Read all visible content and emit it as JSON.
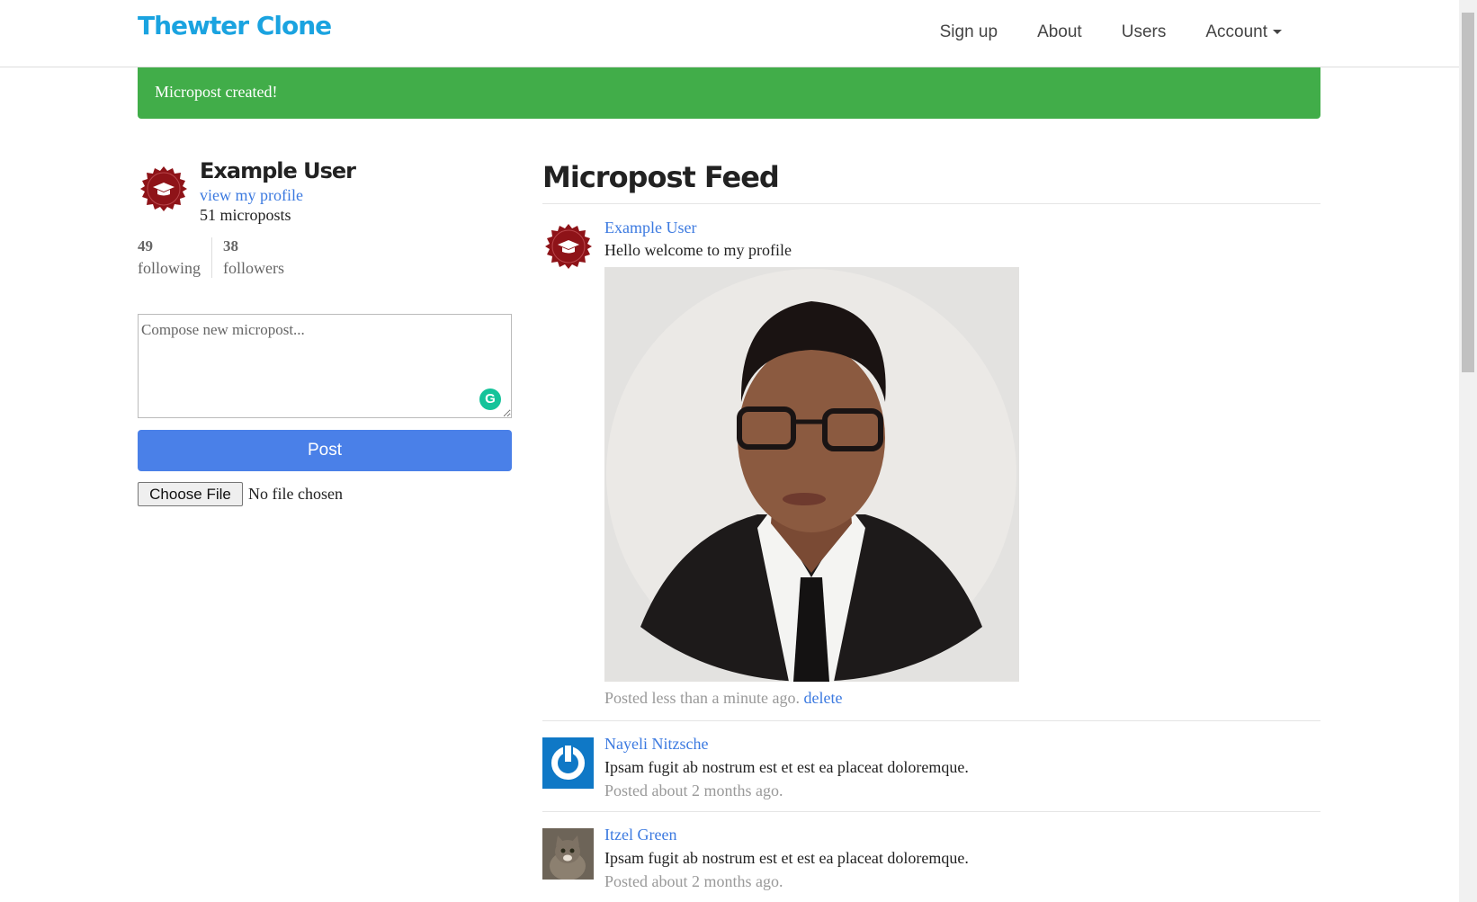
{
  "nav": {
    "brand": "Thewter Clone",
    "links": [
      "Sign up",
      "About",
      "Users",
      "Account"
    ]
  },
  "alert": {
    "message": "Micropost created!"
  },
  "sidebar": {
    "user_name": "Example User",
    "profile_link": "view my profile",
    "micropost_count": "51 microposts",
    "stats": [
      {
        "count": "49",
        "label": "following"
      },
      {
        "count": "38",
        "label": "followers"
      }
    ],
    "compose_placeholder": "Compose new micropost...",
    "post_button": "Post",
    "file_button": "Choose File",
    "file_status": "No file chosen"
  },
  "feed": {
    "title": "Micropost Feed",
    "posts": [
      {
        "user": "Example User",
        "content": "Hello welcome to my profile",
        "time": "Posted less than a minute ago.",
        "action": "delete"
      },
      {
        "user": "Nayeli Nitzsche",
        "content": "Ipsam fugit ab nostrum est et est ea placeat doloremque.",
        "time": "Posted about 2 months ago."
      },
      {
        "user": "Itzel Green",
        "content": "Ipsam fugit ab nostrum est et est ea placeat doloremque.",
        "time": "Posted about 2 months ago."
      }
    ]
  },
  "colors": {
    "brand": "#1aa3e0",
    "alert": "#41ad49",
    "link": "#3c7ae0",
    "button": "#4a80e8"
  }
}
